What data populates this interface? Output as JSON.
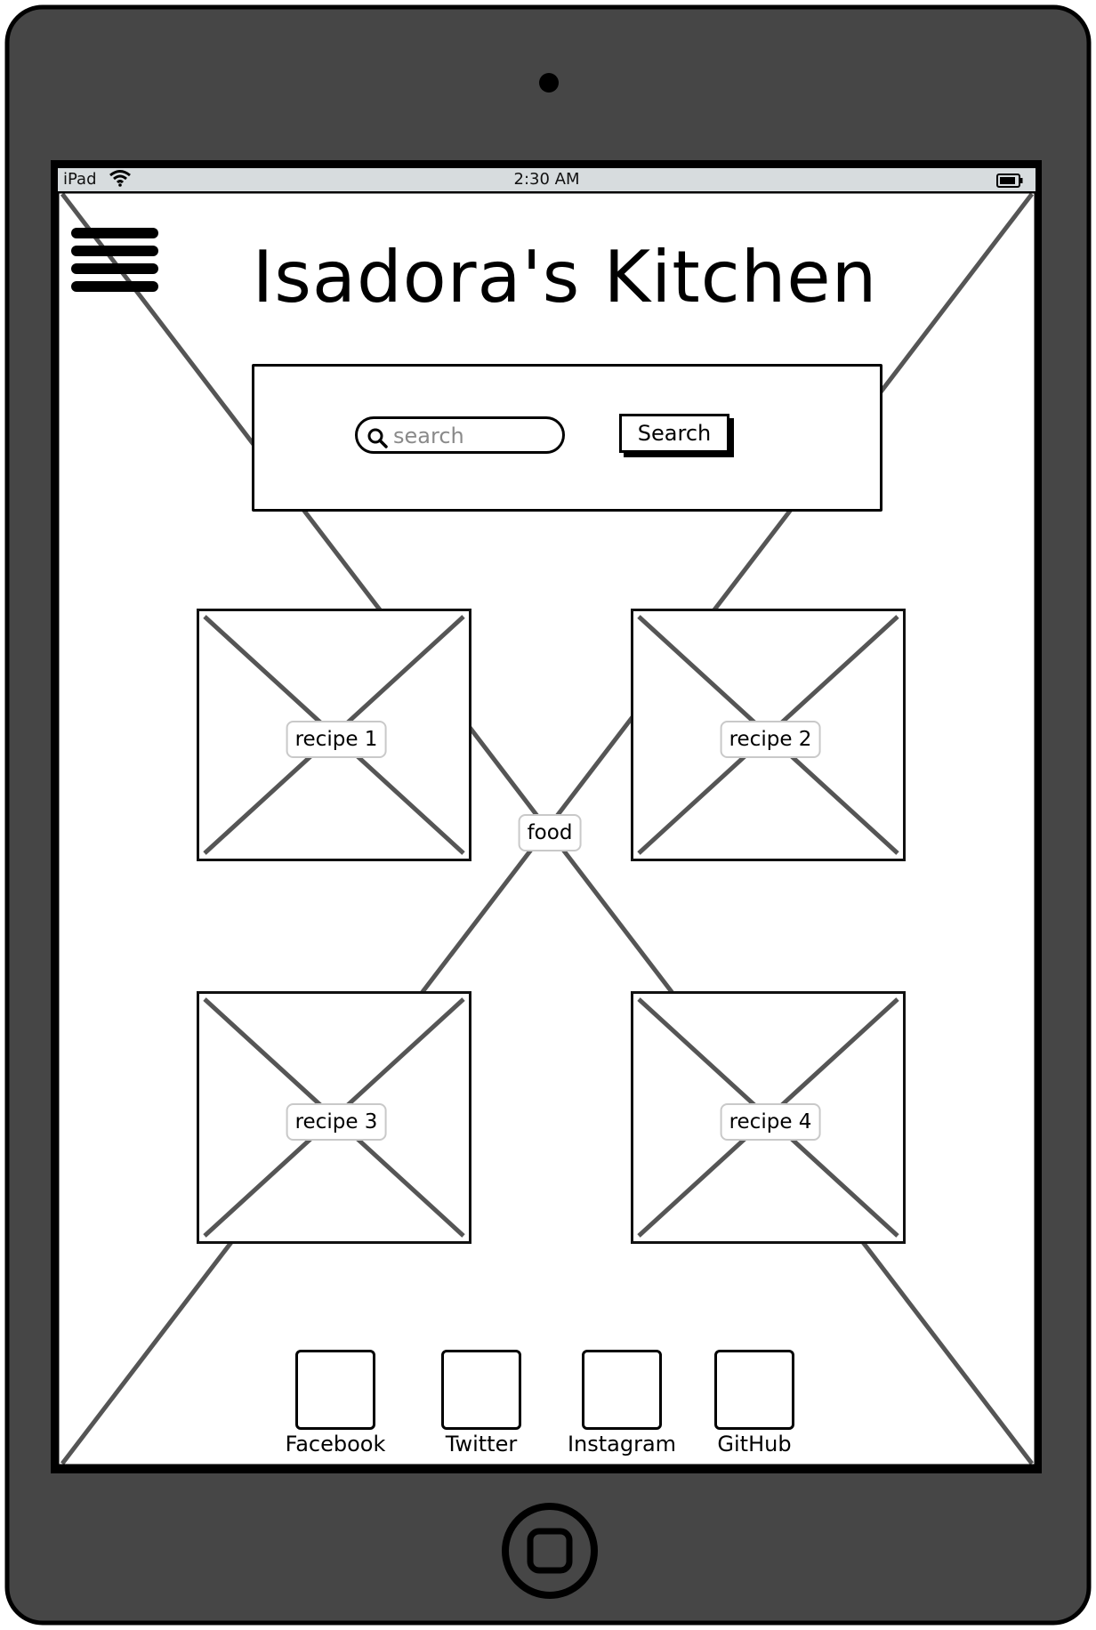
{
  "status_bar": {
    "device": "iPad",
    "time": "2:30 AM",
    "wifi_icon": "wifi-icon",
    "battery_icon": "battery-icon"
  },
  "header": {
    "menu_icon": "hamburger-menu-icon",
    "title": "Isadora's Kitchen"
  },
  "search": {
    "placeholder": "search",
    "button_label": "Search"
  },
  "background_image_label": "food",
  "recipes": [
    {
      "label": "recipe 1"
    },
    {
      "label": "recipe 2"
    },
    {
      "label": "recipe 3"
    },
    {
      "label": "recipe 4"
    }
  ],
  "social": [
    {
      "label": "Facebook"
    },
    {
      "label": "Twitter"
    },
    {
      "label": "Instagram"
    },
    {
      "label": "GitHub"
    }
  ],
  "colors": {
    "device_frame": "#464646",
    "status_bar": "#d7dcde",
    "placeholder_x": "#555555"
  }
}
